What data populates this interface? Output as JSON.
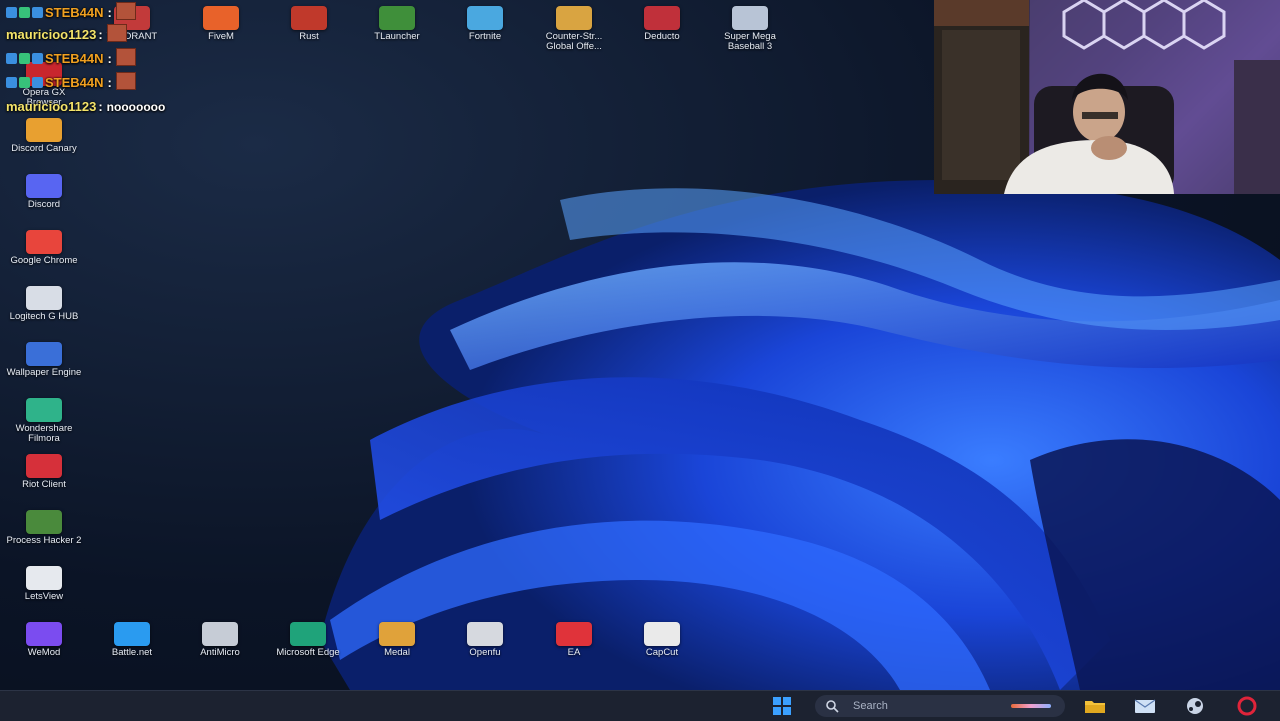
{
  "chat": {
    "messages": [
      {
        "user": "STEB44N",
        "sep": ":",
        "text": "",
        "user_color": "#f0a020",
        "has_emote": true
      },
      {
        "user": "mauricioo1123",
        "sep": ":",
        "text": "",
        "user_color": "#f3e36a",
        "has_emote": true
      },
      {
        "user": "STEB44N",
        "sep": ":",
        "text": "",
        "user_color": "#f0a020",
        "has_emote": true
      },
      {
        "user": "STEB44N",
        "sep": ":",
        "text": "",
        "user_color": "#f0a020",
        "has_emote": true
      },
      {
        "user": "mauricioo1123",
        "sep": ":",
        "text": "nooooooo",
        "user_color": "#f3e36a",
        "has_emote": false
      }
    ]
  },
  "desktop": {
    "top_row": [
      {
        "label": "VALORANT",
        "icon": "valorant-icon",
        "color": "#c23a3a"
      },
      {
        "label": "FiveM",
        "icon": "fivem-icon",
        "color": "#e8622a"
      },
      {
        "label": "Rust",
        "icon": "rust-icon",
        "color": "#c0392b"
      },
      {
        "label": "TLauncher",
        "icon": "tlauncher-icon",
        "color": "#3f8f3a"
      },
      {
        "label": "Fortnite",
        "icon": "fortnite-icon",
        "color": "#4aa8e0"
      },
      {
        "label": "Counter-Str... Global Offe...",
        "icon": "csgo-icon",
        "color": "#d9a441"
      },
      {
        "label": "Deducto",
        "icon": "deducto-icon",
        "color": "#c0303a"
      },
      {
        "label": "Super Mega Baseball 3",
        "icon": "baseball-icon",
        "color": "#b8c4d6"
      }
    ],
    "left_column": [
      {
        "label": "Opera GX Browser",
        "icon": "opera-gx-icon",
        "color": "#c8262e"
      },
      {
        "label": "Discord Canary",
        "icon": "discord-canary-icon",
        "color": "#e8a030"
      },
      {
        "label": "Discord",
        "icon": "discord-icon",
        "color": "#5865f2"
      },
      {
        "label": "Google Chrome",
        "icon": "chrome-icon",
        "color": "#e8453c"
      },
      {
        "label": "Logitech G HUB",
        "icon": "logitech-icon",
        "color": "#d8dde6"
      },
      {
        "label": "Wallpaper Engine",
        "icon": "wallpaper-engine-icon",
        "color": "#3a6fd8"
      },
      {
        "label": "Wondershare Filmora",
        "icon": "filmora-icon",
        "color": "#2fb38a"
      },
      {
        "label": "Riot Client",
        "icon": "riot-icon",
        "color": "#d6303a"
      },
      {
        "label": "Process Hacker 2",
        "icon": "process-hacker-icon",
        "color": "#4a8a3c"
      },
      {
        "label": "LetsView",
        "icon": "letsview-icon",
        "color": "#e6e9ee"
      }
    ],
    "bottom_row": [
      {
        "label": "WeMod",
        "icon": "wemod-icon",
        "color": "#7b4cf0"
      },
      {
        "label": "Battle.net",
        "icon": "battlenet-icon",
        "color": "#2a9bf0"
      },
      {
        "label": "AntiMicro",
        "icon": "antimicro-icon",
        "color": "#c6ccd6"
      },
      {
        "label": "Microsoft Edge",
        "icon": "edge-icon",
        "color": "#1fa37a"
      },
      {
        "label": "Medal",
        "icon": "medal-icon",
        "color": "#e0a23a"
      },
      {
        "label": "Openfu",
        "icon": "openfu-icon",
        "color": "#d6d9df"
      },
      {
        "label": "EA",
        "icon": "ea-icon",
        "color": "#e0333a"
      },
      {
        "label": "CapCut",
        "icon": "capcut-icon",
        "color": "#eaeaea"
      }
    ]
  },
  "taskbar": {
    "search_placeholder": "Search",
    "items": [
      "start-icon",
      "search-icon",
      "file-explorer-icon",
      "mail-icon",
      "steam-icon",
      "opera-gx-icon"
    ]
  }
}
